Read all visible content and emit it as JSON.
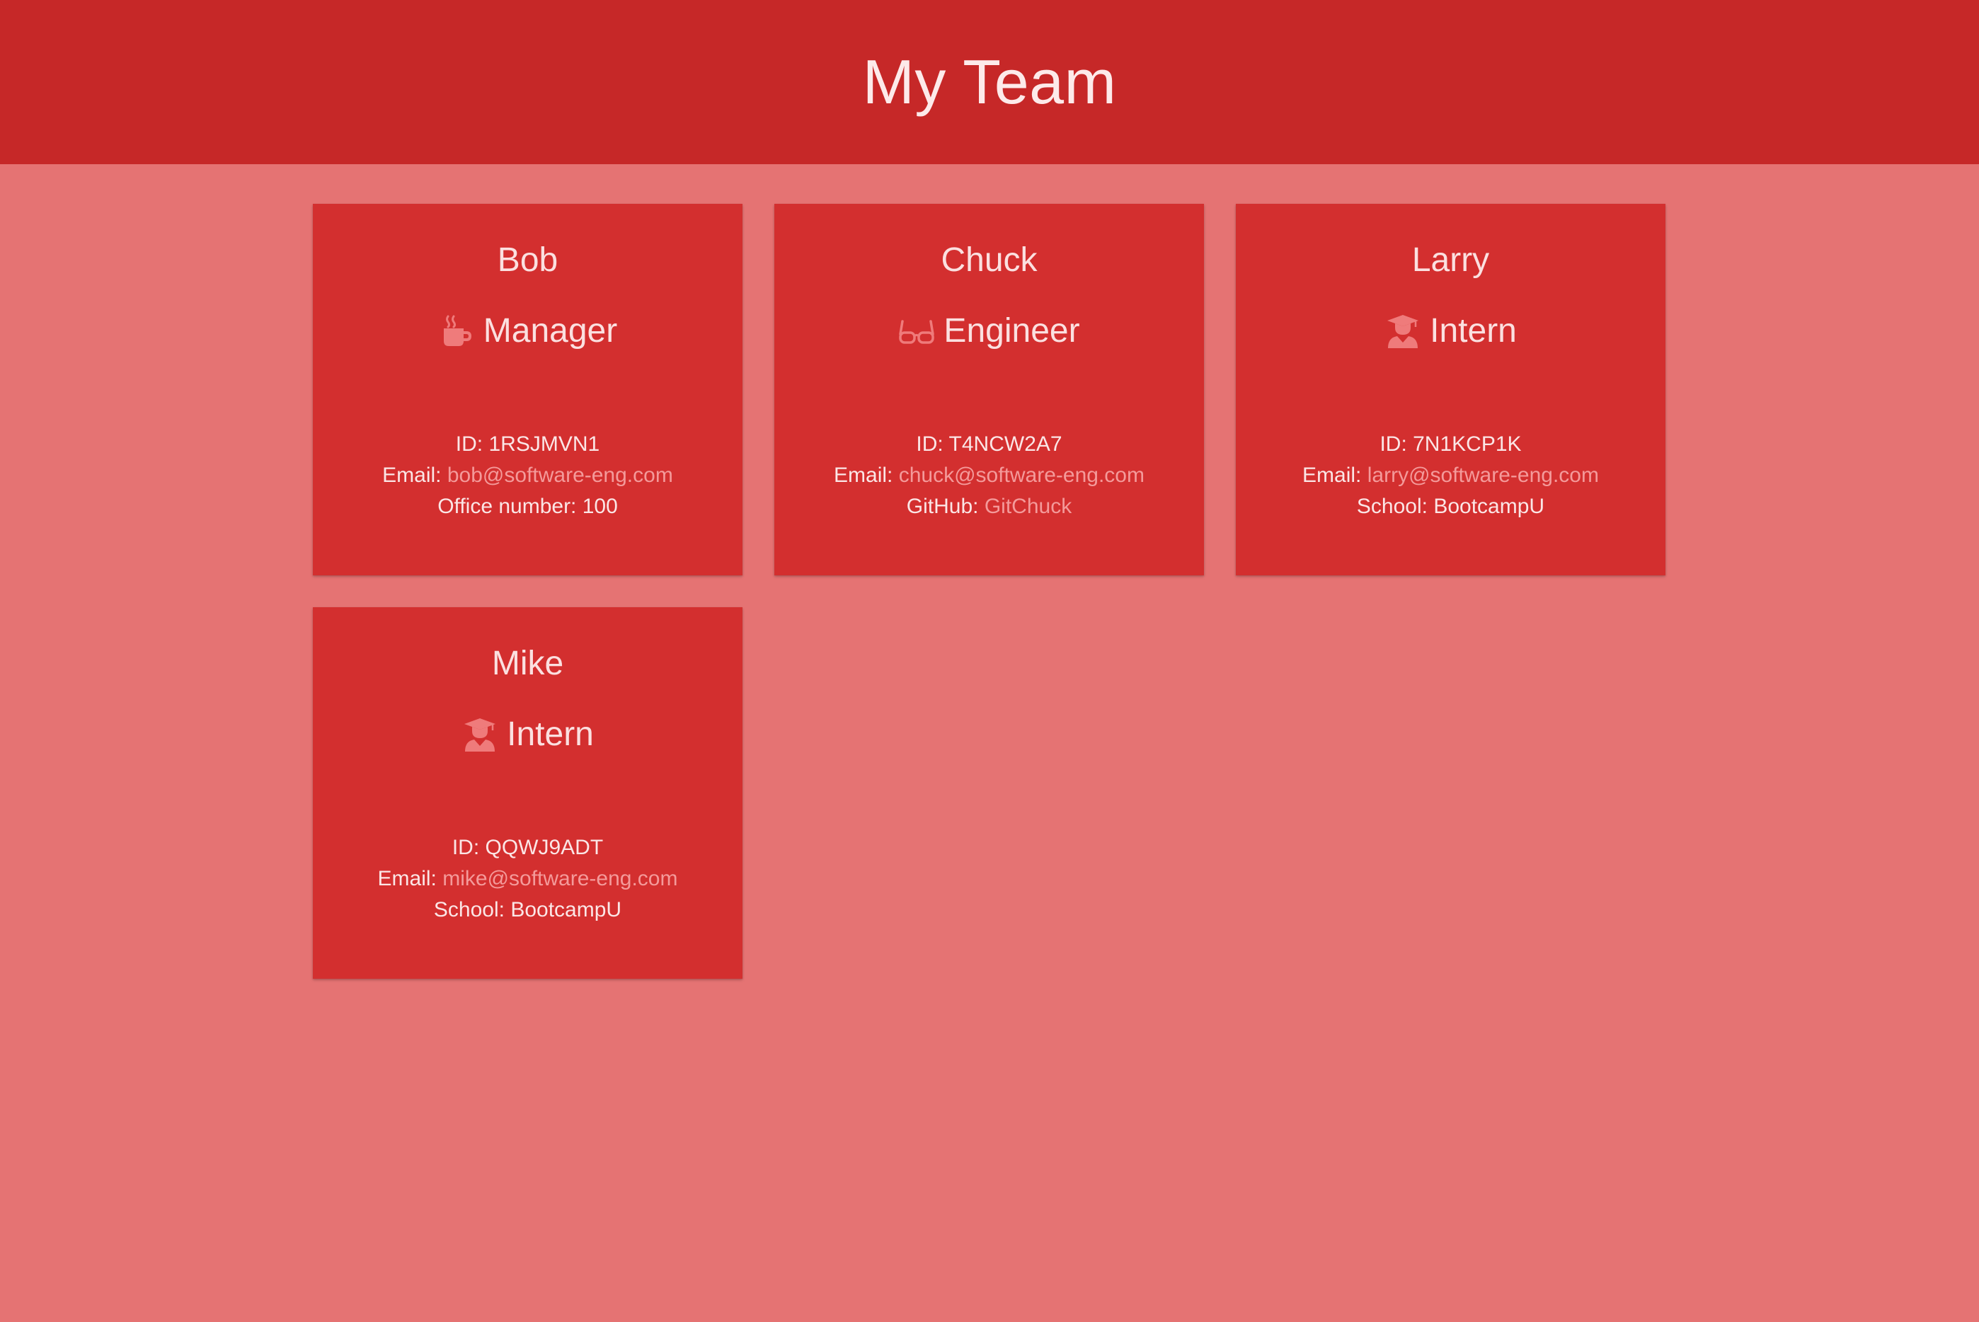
{
  "header": {
    "title": "My Team"
  },
  "labels": {
    "id": "ID:",
    "email": "Email:",
    "office": "Office number:",
    "github": "GitHub:",
    "school": "School:"
  },
  "employees": [
    {
      "name": "Bob",
      "role": "Manager",
      "role_icon": "coffee-mug-icon",
      "id": "1RSJMVN1",
      "email": "bob@software-eng.com",
      "office_number": "100"
    },
    {
      "name": "Chuck",
      "role": "Engineer",
      "role_icon": "glasses-icon",
      "id": "T4NCW2A7",
      "email": "chuck@software-eng.com",
      "github": "GitChuck"
    },
    {
      "name": "Larry",
      "role": "Intern",
      "role_icon": "graduate-icon",
      "id": "7N1KCP1K",
      "email": "larry@software-eng.com",
      "school": "BootcampU"
    },
    {
      "name": "Mike",
      "role": "Intern",
      "role_icon": "graduate-icon",
      "id": "QQWJ9ADT",
      "email": "mike@software-eng.com",
      "school": "BootcampU"
    }
  ],
  "colors": {
    "header_bg": "#c62828",
    "page_bg": "#e57373",
    "card_bg": "#d32f2f",
    "link": "#f49a9a",
    "icon": "#ef7b7b"
  }
}
